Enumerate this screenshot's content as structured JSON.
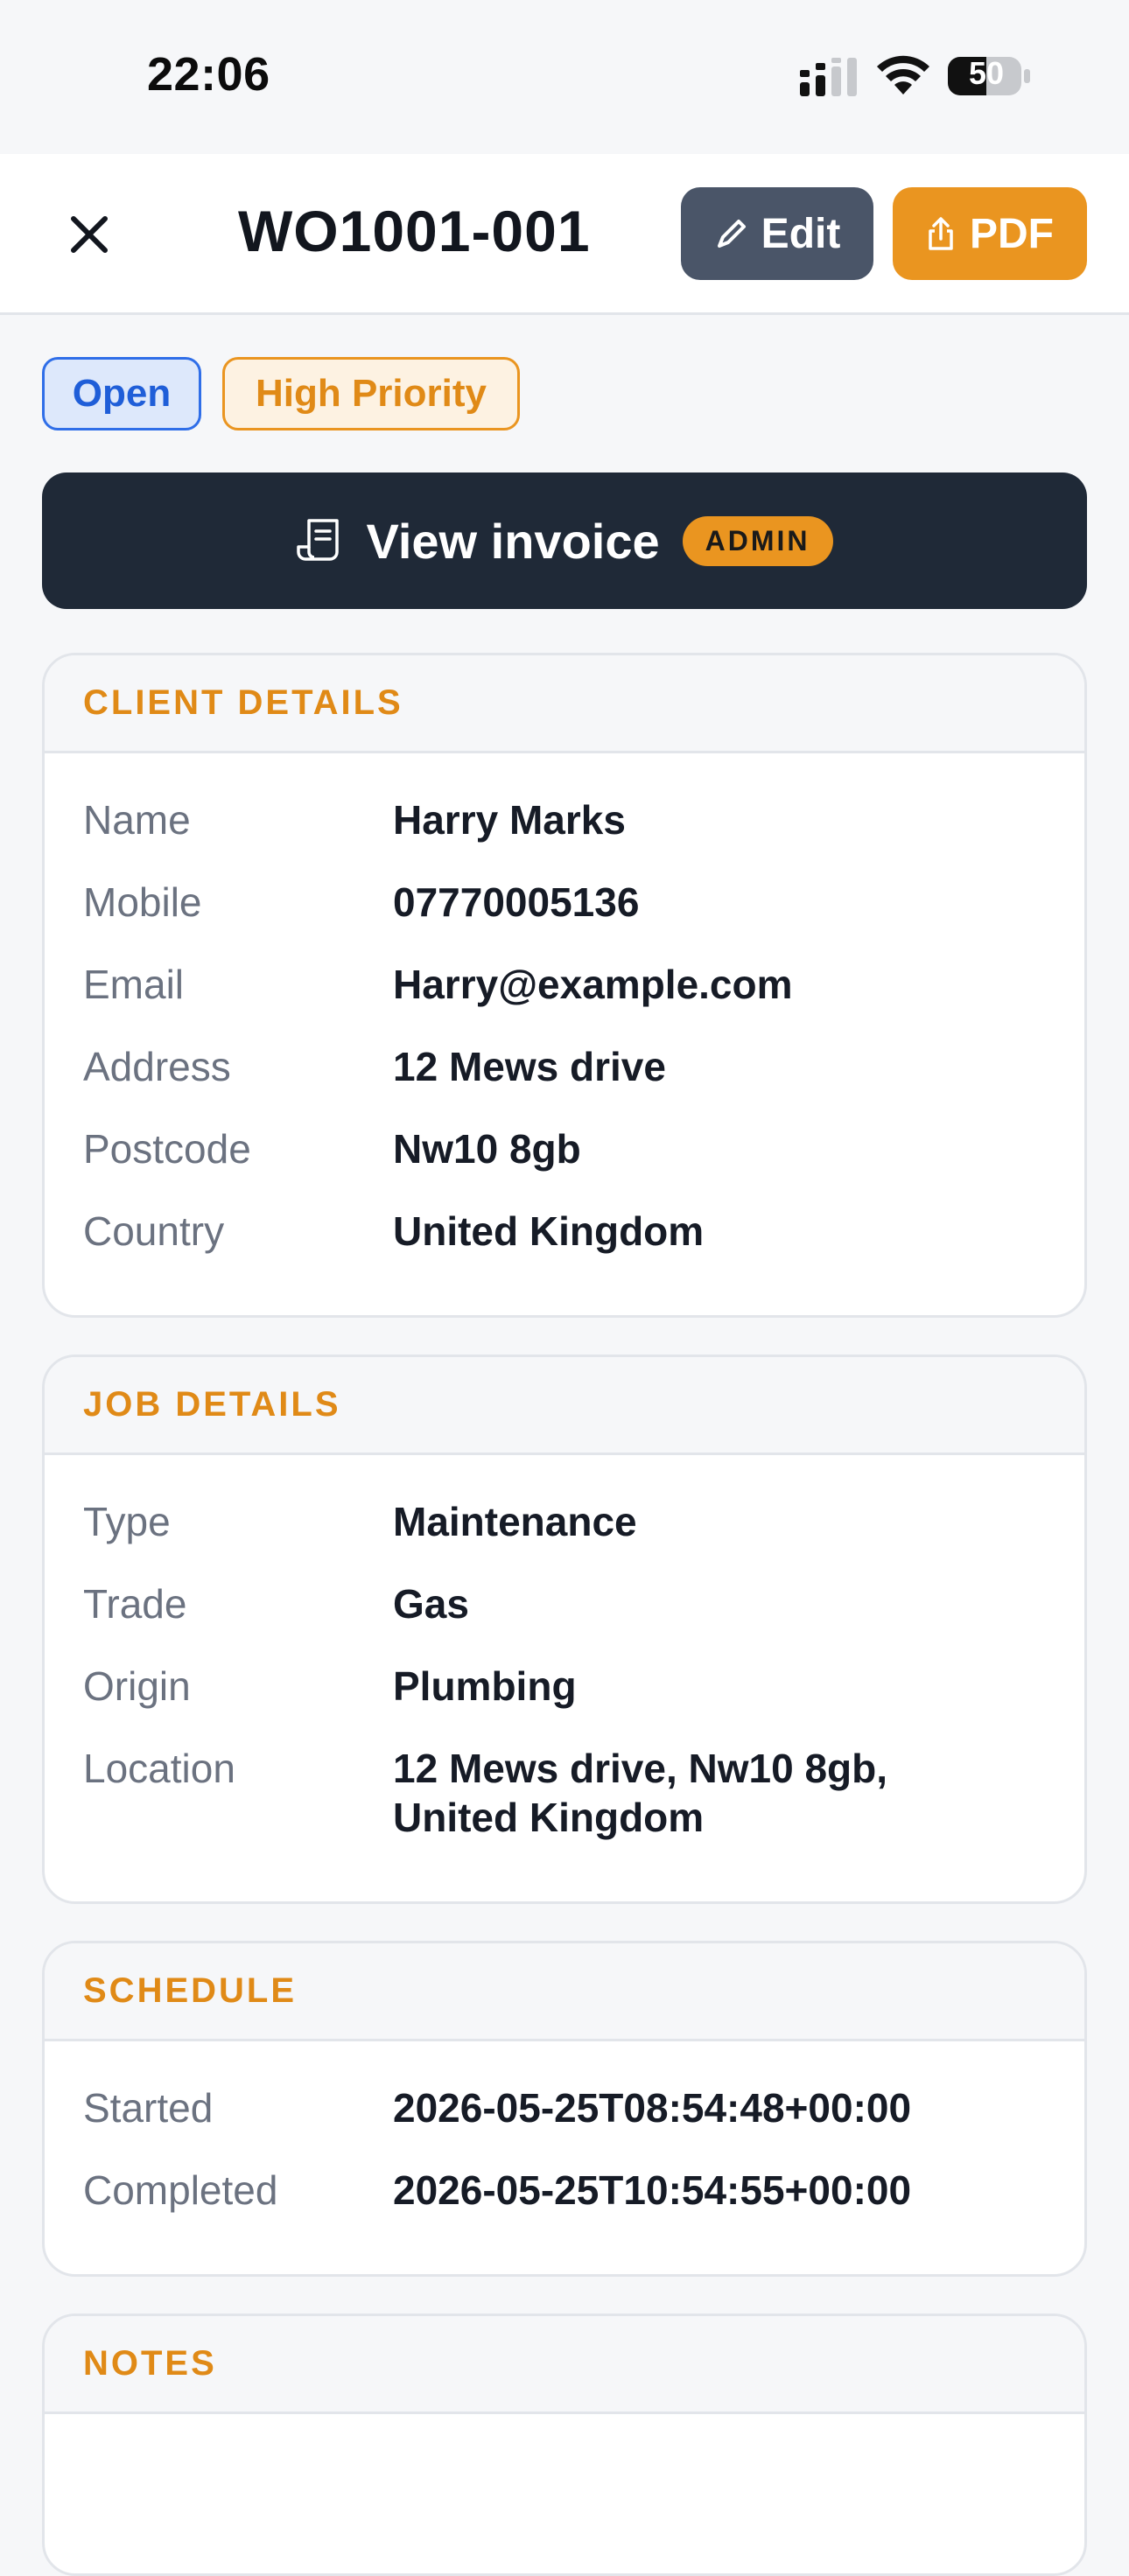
{
  "status": {
    "time": "22:06",
    "battery": "50"
  },
  "header": {
    "title": "WO1001-001",
    "edit_label": "Edit",
    "pdf_label": "PDF"
  },
  "badges": {
    "status": "Open",
    "priority": "High Priority"
  },
  "invoice": {
    "label": "View invoice",
    "tag": "ADMIN"
  },
  "client": {
    "title": "CLIENT DETAILS",
    "rows": [
      {
        "key": "Name",
        "value": "Harry Marks"
      },
      {
        "key": "Mobile",
        "value": "07770005136"
      },
      {
        "key": "Email",
        "value": "Harry@example.com"
      },
      {
        "key": "Address",
        "value": "12 Mews drive"
      },
      {
        "key": "Postcode",
        "value": "Nw10 8gb"
      },
      {
        "key": "Country",
        "value": "United Kingdom"
      }
    ]
  },
  "job": {
    "title": "JOB DETAILS",
    "rows": [
      {
        "key": "Type",
        "value": "Maintenance"
      },
      {
        "key": "Trade",
        "value": "Gas"
      },
      {
        "key": "Origin",
        "value": "Plumbing"
      },
      {
        "key": "Location",
        "value_line1": "12 Mews drive, Nw10 8gb,",
        "value_line2": "United Kingdom"
      }
    ]
  },
  "schedule": {
    "title": "SCHEDULE",
    "rows": [
      {
        "key": "Started",
        "value": "2026-05-25T08:54:48+00:00"
      },
      {
        "key": "Completed",
        "value": "2026-05-25T10:54:55+00:00"
      }
    ]
  },
  "notes": {
    "title": "NOTES"
  },
  "colors": {
    "accent": "#ea9520",
    "dark": "#1f2937",
    "edit": "#4a5568",
    "open_blue": "#2f6ee8"
  }
}
